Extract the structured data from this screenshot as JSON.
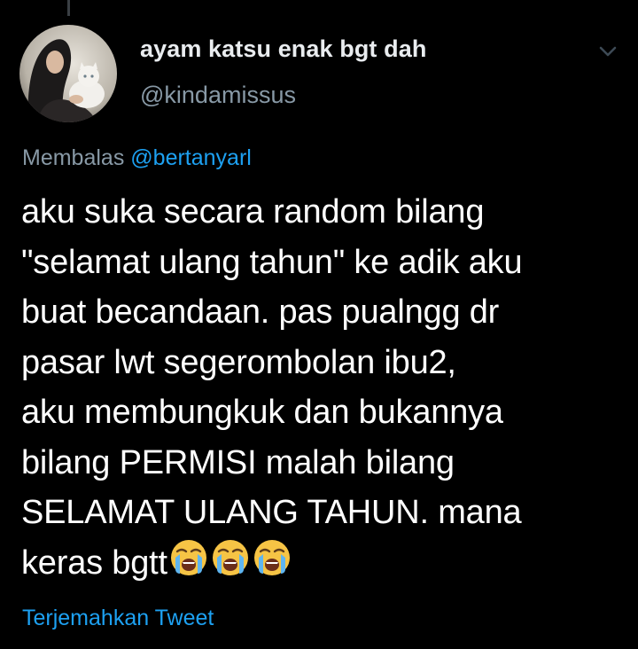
{
  "tweet": {
    "display_name": "ayam katsu enak bgt dah",
    "handle": "@kindamissus",
    "reply_prefix": "Membalas",
    "reply_to": "@bertanyarl",
    "text": "aku suka secara random bilang\n\"selamat ulang tahun\" ke adik aku\nbuat becandaan. pas pualngg dr\npasar lwt segerombolan ibu2,\naku membungkuk dan bukannya\nbilang PERMISI malah bilang\nSELAMAT ULANG TAHUN. mana\nkeras bgtt",
    "emojis": [
      "loudly-crying-face",
      "loudly-crying-face",
      "loudly-crying-face"
    ],
    "translate_label": "Terjemahkan Tweet"
  },
  "icons": {
    "menu": "chevron-down-icon",
    "avatar": "avatar"
  },
  "colors": {
    "background": "#000000",
    "primary_text": "#ffffff",
    "secondary_text": "#8899a6",
    "accent": "#1da1f2"
  }
}
